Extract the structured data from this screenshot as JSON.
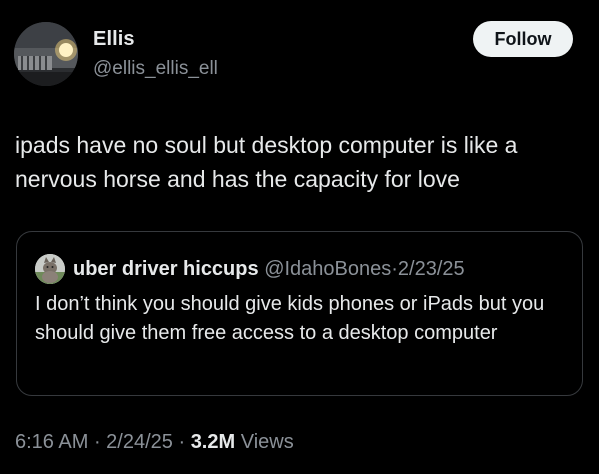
{
  "author": {
    "display_name": "Ellis",
    "handle": "@ellis_ellis_ell",
    "avatar_icon": "car-headlight-photo-icon"
  },
  "follow_label": "Follow",
  "tweet": {
    "text": "ipads have no soul but desktop computer is like a nervous horse and has the capacity for love"
  },
  "quoted": {
    "display_name": "uber driver hiccups",
    "handle": "@IdahoBones",
    "separator": "·",
    "date": "2/23/25",
    "text": "I don’t think you should give kids phones or iPads but you should give them free access to a desktop computer",
    "avatar_icon": "cat-photo-icon"
  },
  "meta": {
    "time": "6:16 AM",
    "sep1": " · ",
    "date": "2/24/25",
    "sep2": " · ",
    "views_count": "3.2M",
    "views_label": " Views"
  },
  "colors": {
    "background": "#000000",
    "primary_text": "#e7e9ea",
    "secondary_text": "#8b9198",
    "follow_bg": "#eff3f4",
    "border": "#36393d"
  }
}
